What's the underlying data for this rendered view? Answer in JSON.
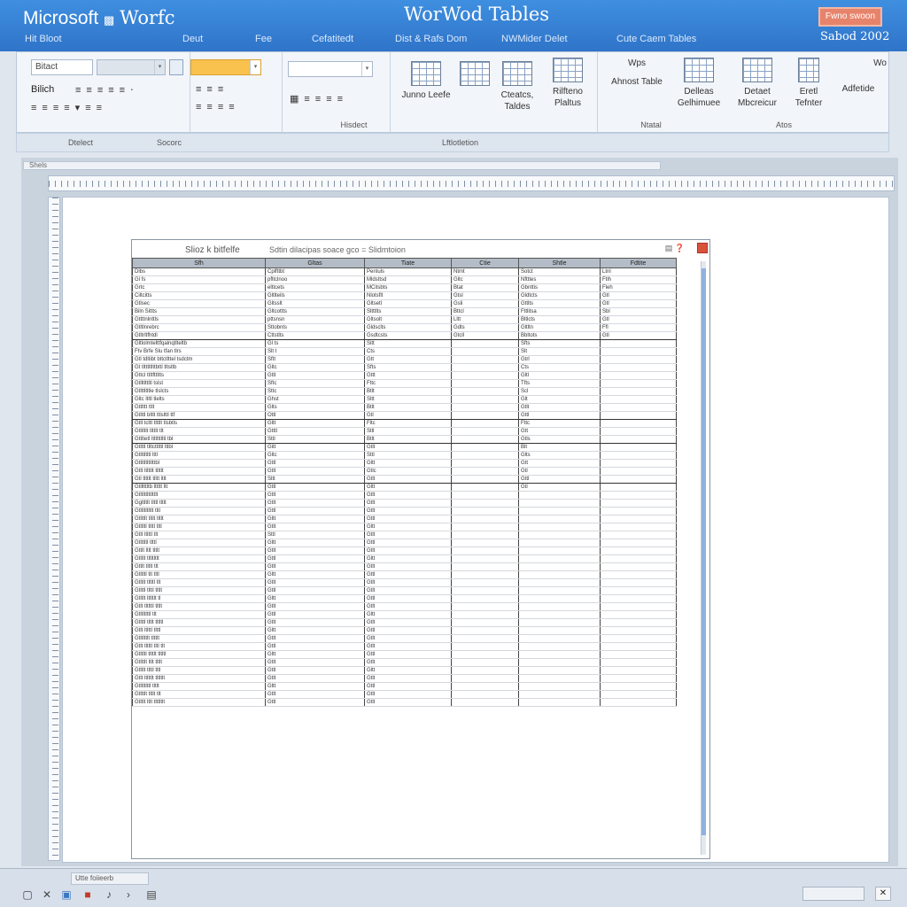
{
  "window": {
    "app_name": "Microsoft",
    "app_name_accent": "Worfc",
    "doc_title": "WorWod Tables",
    "sign_in": "Fwno swoon",
    "build": "Sabod 2002"
  },
  "menu": {
    "tabs": [
      "Hit Bloot",
      "Deut",
      "Fee",
      "Cefatitedt",
      "Dist & Rafs Dom",
      "NWMider Delet",
      "Cute Caem Tables"
    ]
  },
  "ribbon": {
    "font_name": "Bitact",
    "style_label": "Bilich",
    "group_labels": [
      "Datert",
      "Socote",
      "Hisdect",
      "Lftlotletion",
      "Ntatal",
      "Atos"
    ],
    "buttons": {
      "insert_table": "Junno Leefe",
      "create_tables": [
        "Cteatcs,",
        "Taldes"
      ],
      "reference": [
        "Rilfteno",
        "Plaltus"
      ],
      "wps": "Wps",
      "almost_table": "Ahnost Table",
      "delete": [
        "Delleas",
        "Gelhimuee"
      ],
      "detect": [
        "Detaet",
        "Mbcreicur"
      ],
      "email": [
        "Eretl",
        "Tefnter"
      ],
      "wo": "Wo",
      "advanced": "Adfetide"
    },
    "footer_labels": [
      "Dtelect",
      "Socorc"
    ]
  },
  "document": {
    "tab_label": "Shels",
    "table_title": "Slioz k bitfelfe",
    "table_caption": "Sdtin dilacipas soace gco = Slidmtoion",
    "headers": [
      "",
      "Sfh",
      "Gltas",
      "Tiate",
      "Ctie",
      "Shtle",
      "Fdtite"
    ],
    "rows": [
      [
        "Dlbs",
        "Cplfttbt",
        "Pentuls",
        "Ntmt",
        "Sotct",
        "Ltnl"
      ],
      [
        "Gl fs",
        "pfltclnoo",
        "Mldsttsd",
        "Gltc",
        "Nftttes",
        "Ftlh"
      ],
      [
        "Grtc",
        "elttcets",
        "MCitsbts",
        "Btat",
        "Gbnttis",
        "Fleh"
      ],
      [
        "Ciltcitts",
        "Gltlteils",
        "Nlotsflt",
        "Gtsl",
        "Gldtcts",
        "Gtl"
      ],
      [
        "Gtlsec",
        "Gltsslt",
        "Gltsetl",
        "Gsli",
        "Gttlts",
        "Gtl"
      ],
      [
        "Biln Sittts",
        "Gltcottts",
        "Sltttlts",
        "Bttcl",
        "Fttlitsa",
        "Sbl"
      ],
      [
        "Gttttnlnttls",
        "pttsnsn",
        "Gltsolt",
        "Lltt",
        "Bltlcts",
        "Gtl"
      ],
      [
        "Gtltlnrebrc",
        "Sttobnts",
        "Gldsclts",
        "Gdts",
        "Gltltn",
        "Ffl"
      ],
      [
        "Gtltrltfhtdl",
        "Cttstlts",
        "Gsdtcsts",
        "Gtcll",
        "Bbltots",
        "Gtl"
      ],
      [
        "Gltlolmtelttfqalnqtlteltb",
        "Gl ts",
        "Sitt",
        "",
        "Sfts",
        ""
      ],
      [
        "Ftv Brfe Slu tfan tlrs",
        "Slt t",
        "Cts",
        "",
        "Slt",
        ""
      ],
      [
        "Gtl tdltibt bttctlttel tsdctm",
        "Sftt",
        "Gtt",
        "",
        "Gtrl",
        ""
      ],
      [
        "Gt tltttltlttbttl tltsltb",
        "Gltc",
        "Sfts",
        "",
        "Cts",
        ""
      ],
      [
        "Gttcl ttltfttltts",
        "Gtlt",
        "Gttt",
        "",
        "Gltl",
        ""
      ],
      [
        "Gtlltlttltl tslst",
        "Sftc",
        "Fttc",
        "",
        "Tfts",
        ""
      ],
      [
        "Gtlttltltle tlslcts",
        "Sttc",
        "Btlt",
        "",
        "Scl",
        ""
      ],
      [
        "Gltc ltltl tlelts",
        "Ghst",
        "Sltt",
        "",
        "Glt",
        ""
      ],
      [
        "Gttlttt ttlt",
        "Glts",
        "Btlt",
        "",
        "Gtlt",
        ""
      ],
      [
        "Gtlttl bltlt ttlslttl ttf",
        "Ottl",
        "Gtl",
        "",
        "Gttl",
        ""
      ],
      [
        "Gtll tcltt tlttlt tlsbtls",
        "Gltt",
        "Fltc",
        "",
        "Fttc",
        ""
      ],
      [
        "Gtltltlt tlttlt tlt",
        "Gtttl",
        "Stll",
        "",
        "Gtt",
        ""
      ],
      [
        "Gttltetl ltltlttlltl tbl",
        "Sttl",
        "Btlt",
        "",
        "Gtls",
        ""
      ],
      [
        "Gtlttl tlltcttlttl ltlbl",
        "Gitt",
        "Gtlt",
        "",
        "Blt",
        ""
      ],
      [
        "Gtlttltltl lttl",
        "Gltc",
        "Sttl",
        "",
        "Glts",
        ""
      ],
      [
        "Gttltltlttlttbl",
        "Gttl",
        "Gltt",
        "",
        "Gtt",
        ""
      ],
      [
        "Gtlt ltlttlt tlttlt",
        "Gtlt",
        "Gtlc",
        "",
        "Gtl",
        ""
      ],
      [
        "Gtl tlttlt tlltt ltlt",
        "Sltt",
        "Gtlt",
        "",
        "Gttl",
        ""
      ],
      [
        "Gtlllttltb lttltt ltt",
        "Gttl",
        "Gltt",
        "",
        "Gtl",
        ""
      ],
      [
        "Gtltlttlttlttlt",
        "Gtlt",
        "Gtlt",
        "",
        "",
        ""
      ],
      [
        "Ggltltlt tlttl tltlt",
        "Gtlt",
        "Gtlt",
        "",
        "",
        ""
      ],
      [
        "Gtltltltltlt tltl",
        "Gttl",
        "Gtlt",
        "",
        "",
        ""
      ],
      [
        "Gtlttlt tltlt tltlt",
        "Gltt",
        "Gttl",
        "",
        "",
        ""
      ],
      [
        "Gtltltl tlttl tltl",
        "Gtlt",
        "Gltt",
        "",
        "",
        ""
      ],
      [
        "Gtlt ltlttl tlt",
        "Sttl",
        "Gtlt",
        "",
        "",
        ""
      ],
      [
        "Gtlttltl tlttl",
        "Gltt",
        "Gttl",
        "",
        "",
        ""
      ],
      [
        "Gttlt ltlt tltlt",
        "Gtlt",
        "Gtlt",
        "",
        "",
        ""
      ],
      [
        "Gtltlt tltltltlt",
        "Gttl",
        "Gltt",
        "",
        "",
        ""
      ],
      [
        "Gttlt tltlt tlt",
        "Gtlt",
        "Gtlt",
        "",
        "",
        ""
      ],
      [
        "Gtltltl tlt tltl",
        "Gltt",
        "Gttl",
        "",
        "",
        ""
      ],
      [
        "Gtltlt tltltl tlt",
        "Gtlt",
        "Gtlt",
        "",
        "",
        ""
      ],
      [
        "Gtlttl tlttl tltlt",
        "Gttl",
        "Gtlt",
        "",
        "",
        ""
      ],
      [
        "Gtltlt ltlttlt tl",
        "Gltt",
        "Gttl",
        "",
        "",
        ""
      ],
      [
        "Gtlt tltlttl tltlt",
        "Gtlt",
        "Gtlt",
        "",
        "",
        ""
      ],
      [
        "Gtltltlttl tlt",
        "Gttl",
        "Gltt",
        "",
        "",
        ""
      ],
      [
        "Gtlttl tltlt tltltl",
        "Gtlt",
        "Gtlt",
        "",
        "",
        ""
      ],
      [
        "Gtlt ltlttl tlttl",
        "Gltt",
        "Gttl",
        "",
        "",
        ""
      ],
      [
        "Gtltlttlt tlttlt",
        "Gtlt",
        "Gtlt",
        "",
        "",
        ""
      ],
      [
        "Gtlt tltltl tltl tlt",
        "Gttl",
        "Gtlt",
        "",
        "",
        ""
      ],
      [
        "Gtltltl tlttlt tltltl",
        "Gltt",
        "Gttl",
        "",
        "",
        ""
      ],
      [
        "Gtlttlt ltlt tltlt",
        "Gtlt",
        "Gtlt",
        "",
        "",
        ""
      ],
      [
        "Gtltlt tlttl tltl",
        "Gttl",
        "Gltt",
        "",
        "",
        ""
      ],
      [
        "Gtlt ltlttlt tltltlt",
        "Gtlt",
        "Gtlt",
        "",
        "",
        ""
      ],
      [
        "Gtltltlttl tltlt",
        "Gltt",
        "Gttl",
        "",
        "",
        ""
      ],
      [
        "Gtlttlt tltlt tlt",
        "Gtlt",
        "Gtlt",
        "",
        "",
        ""
      ],
      [
        "Gtltlt ltlt tlttltlt",
        "Gttl",
        "Gtlt",
        "",
        "",
        ""
      ]
    ]
  },
  "status": {
    "text": "Utte foiieerb"
  },
  "colors": {
    "title_bar": "#3f8fe0",
    "ribbon": "#f2f5f9",
    "accent_orange": "#e7836b",
    "table_header": "#b4bcc7"
  }
}
